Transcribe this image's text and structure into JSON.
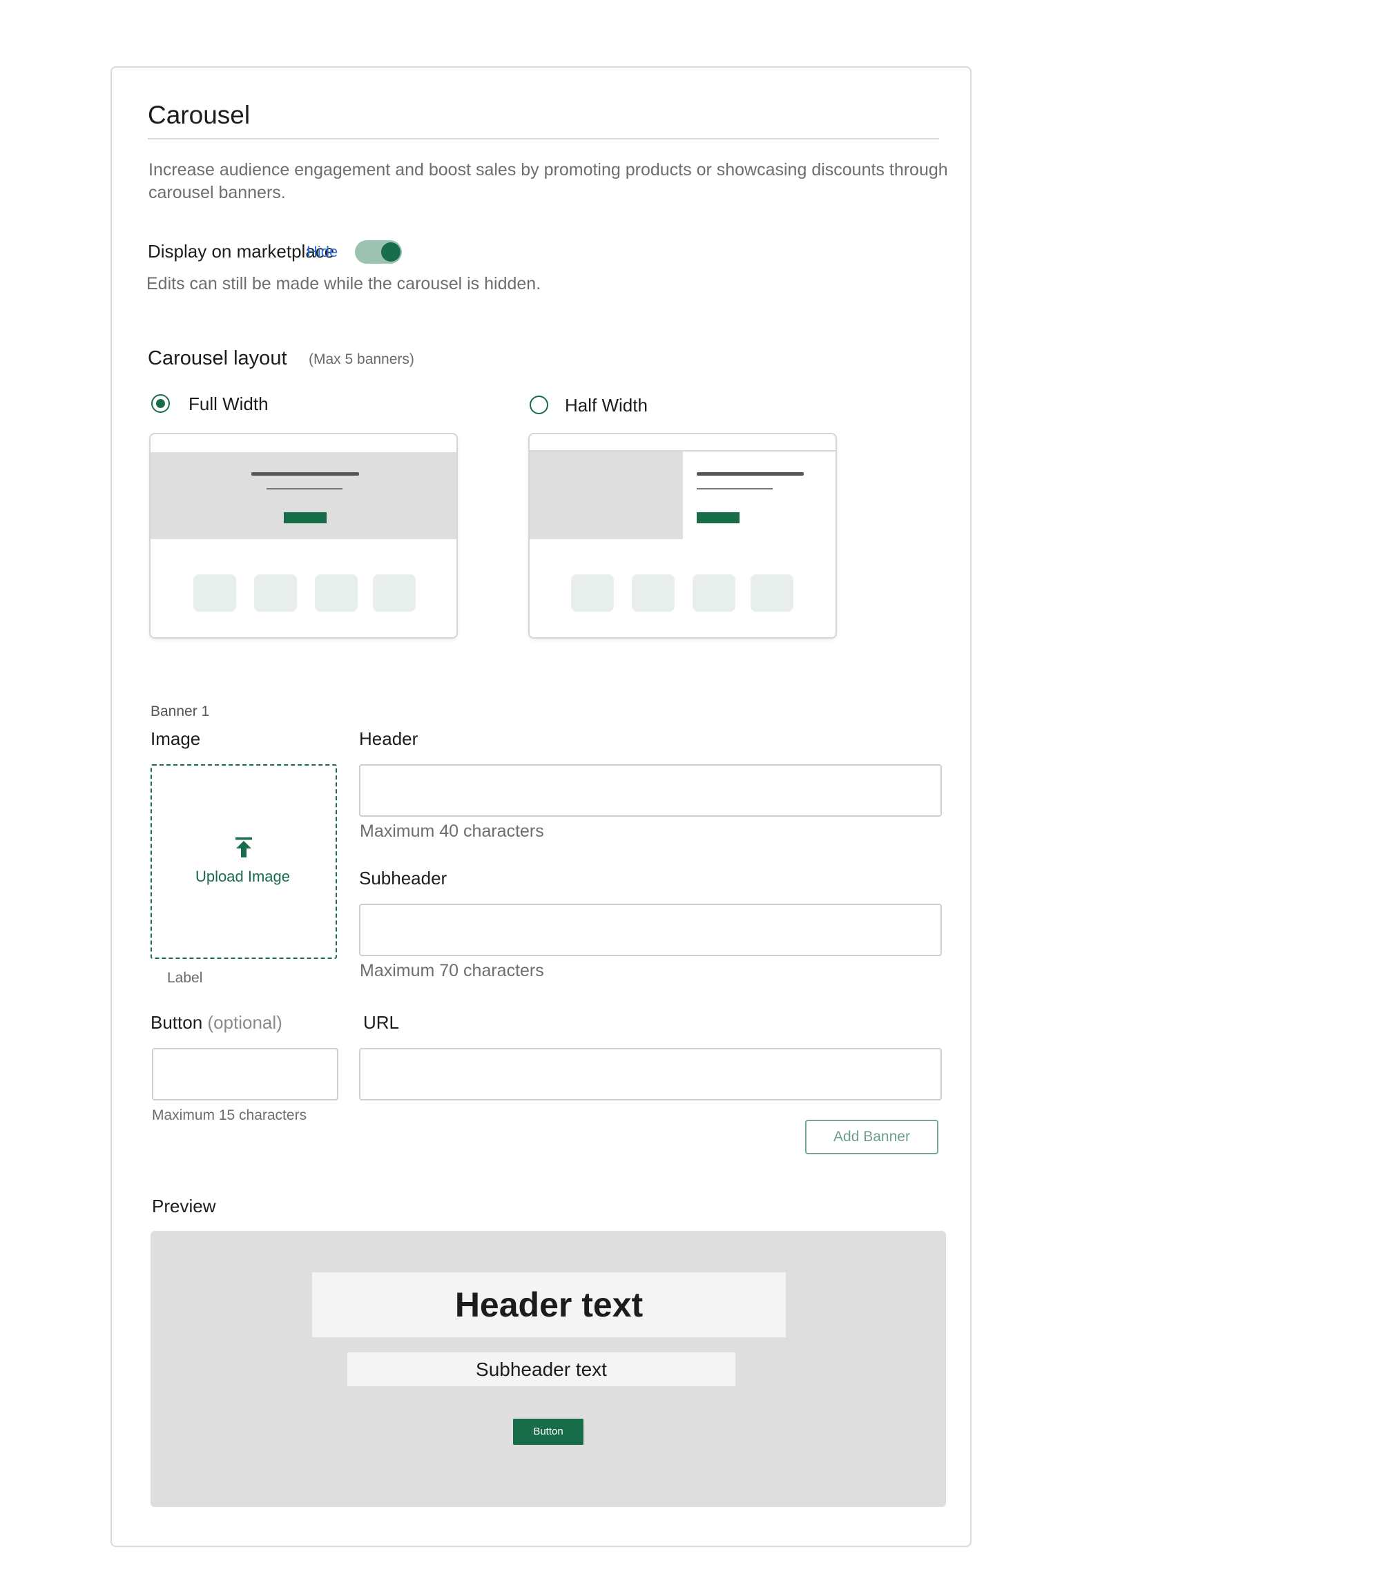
{
  "title": "Carousel",
  "description": "Increase audience engagement and boost sales by promoting products or showcasing discounts through carousel banners.",
  "display": {
    "label": "Display on marketplace",
    "toggle_label": "Hide",
    "toggle_on": true,
    "note": "Edits can still be made while the carousel is hidden."
  },
  "layout": {
    "title": "Carousel layout",
    "max_note": "(Max 5 banners)",
    "options": [
      {
        "label": "Full Width",
        "selected": true
      },
      {
        "label": "Half Width",
        "selected": false
      }
    ]
  },
  "banner": {
    "label": "Banner 1",
    "image_label": "Image",
    "upload_text": "Upload Image",
    "upload_caption": "Label",
    "header_label": "Header",
    "header_value": "",
    "header_hint": "Maximum 40 characters",
    "subheader_label": "Subheader",
    "subheader_value": "",
    "subheader_hint": "Maximum 70 characters",
    "button_label": "Button",
    "button_optional": "(optional)",
    "button_value": "",
    "button_hint": "Maximum 15 characters",
    "url_label": "URL",
    "url_value": "",
    "add_banner": "Add Banner"
  },
  "preview": {
    "label": "Preview",
    "header_text": "Header text",
    "subheader_text": "Subheader text",
    "button_text": "Button"
  },
  "colors": {
    "accent": "#176c4a",
    "toggle_track": "#9cc3b1",
    "link": "#2f6fd6"
  }
}
